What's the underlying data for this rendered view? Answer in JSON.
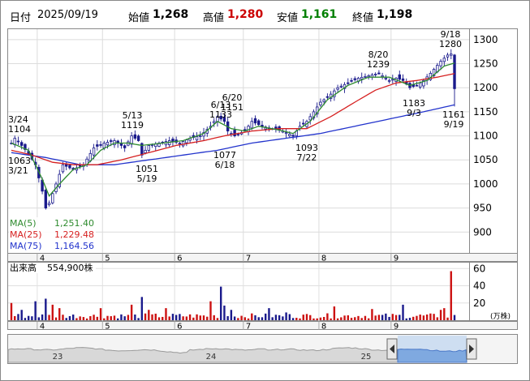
{
  "header": {
    "date_label": "日付",
    "date": "2025/09/19",
    "open_label": "始値",
    "open": "1,268",
    "high_label": "高値",
    "high": "1,280",
    "low_label": "安値",
    "low": "1,161",
    "close_label": "終値",
    "close": "1,198"
  },
  "colors": {
    "up_candle": "#ffffff",
    "down_candle": "#1a1a8c",
    "ma5": "#2e8b2e",
    "ma25": "#d62020",
    "ma75": "#2233cc",
    "high_value": "#cc0000",
    "low_value": "#008000",
    "volume_up": "#cc1111",
    "volume_down": "#1a1a8c"
  },
  "legend": {
    "ma5_label": "MA(5)",
    "ma5_value": "1,251.40",
    "ma25_label": "MA(25)",
    "ma25_value": "1,229.48",
    "ma75_label": "MA(75)",
    "ma75_value": "1,164.56"
  },
  "volume_panel": {
    "label": "出来高",
    "value": "554,900株",
    "unit": "(万株)",
    "ticks": [
      "60",
      "40",
      "20"
    ]
  },
  "navigator": {
    "year_labels": [
      "23",
      "24",
      "25"
    ]
  },
  "chart_data": {
    "type": "candlestick",
    "ylim": [
      860,
      1320
    ],
    "y_ticks": [
      900,
      950,
      1000,
      1050,
      1100,
      1150,
      1200,
      1250,
      1300
    ],
    "x_ticks": [
      "4",
      "5",
      "6",
      "7",
      "8",
      "9"
    ],
    "annotations": [
      {
        "lines": [
          "3/24",
          "1104"
        ],
        "date": "3/24",
        "value": 1104
      },
      {
        "lines": [
          "1063",
          "3/21"
        ],
        "date": "3/21",
        "value": 1063
      },
      {
        "lines": [
          "5/13",
          "1119"
        ],
        "date": "5/13",
        "value": 1119
      },
      {
        "lines": [
          "1051",
          "5/19"
        ],
        "date": "5/19",
        "value": 1051
      },
      {
        "lines": [
          "6/20",
          "1151"
        ],
        "date": "6/20",
        "value": 1151
      },
      {
        "lines": [
          "6/13",
          "1133"
        ],
        "date": "6/13",
        "value": 1133
      },
      {
        "lines": [
          "1077",
          "6/18"
        ],
        "date": "6/18",
        "value": 1077
      },
      {
        "lines": [
          "1093",
          "7/22"
        ],
        "date": "7/22",
        "value": 1093
      },
      {
        "lines": [
          "8/20",
          "1239"
        ],
        "date": "8/20",
        "value": 1239
      },
      {
        "lines": [
          "1183",
          "9/3"
        ],
        "date": "9/3",
        "value": 1183
      },
      {
        "lines": [
          "9/18",
          "1280"
        ],
        "date": "9/18",
        "value": 1280
      },
      {
        "lines": [
          "1161",
          "9/19"
        ],
        "date": "9/19",
        "value": 1161
      }
    ],
    "ohlc_anchors": [
      {
        "i": 0,
        "close": 1085
      },
      {
        "i": 1,
        "close": 1095
      },
      {
        "i": 3,
        "close": 1080
      },
      {
        "i": 5,
        "close": 1063
      },
      {
        "i": 7,
        "close": 1040
      },
      {
        "i": 9,
        "close": 985
      },
      {
        "i": 10,
        "close": 950
      },
      {
        "i": 11,
        "close": 960
      },
      {
        "i": 13,
        "close": 1000
      },
      {
        "i": 15,
        "close": 1040
      },
      {
        "i": 18,
        "close": 1030
      },
      {
        "i": 21,
        "close": 1040
      },
      {
        "i": 24,
        "close": 1075
      },
      {
        "i": 27,
        "close": 1085
      },
      {
        "i": 30,
        "close": 1090
      },
      {
        "i": 33,
        "close": 1075
      },
      {
        "i": 35,
        "close": 1100
      },
      {
        "i": 37,
        "close": 1090
      },
      {
        "i": 38,
        "close": 1060
      },
      {
        "i": 40,
        "close": 1080
      },
      {
        "i": 43,
        "close": 1085
      },
      {
        "i": 46,
        "close": 1090
      },
      {
        "i": 49,
        "close": 1085
      },
      {
        "i": 52,
        "close": 1095
      },
      {
        "i": 55,
        "close": 1100
      },
      {
        "i": 58,
        "close": 1120
      },
      {
        "i": 60,
        "close": 1140
      },
      {
        "i": 62,
        "close": 1130
      },
      {
        "i": 63,
        "close": 1110
      },
      {
        "i": 65,
        "close": 1100
      },
      {
        "i": 68,
        "close": 1110
      },
      {
        "i": 70,
        "close": 1130
      },
      {
        "i": 73,
        "close": 1120
      },
      {
        "i": 76,
        "close": 1115
      },
      {
        "i": 79,
        "close": 1110
      },
      {
        "i": 82,
        "close": 1100
      },
      {
        "i": 84,
        "close": 1120
      },
      {
        "i": 86,
        "close": 1130
      },
      {
        "i": 88,
        "close": 1150
      },
      {
        "i": 90,
        "close": 1170
      },
      {
        "i": 92,
        "close": 1180
      },
      {
        "i": 95,
        "close": 1200
      },
      {
        "i": 98,
        "close": 1210
      },
      {
        "i": 101,
        "close": 1220
      },
      {
        "i": 104,
        "close": 1225
      },
      {
        "i": 107,
        "close": 1230
      },
      {
        "i": 110,
        "close": 1215
      },
      {
        "i": 112,
        "close": 1220
      },
      {
        "i": 114,
        "close": 1215
      },
      {
        "i": 116,
        "close": 1200
      },
      {
        "i": 118,
        "close": 1205
      },
      {
        "i": 120,
        "close": 1215
      },
      {
        "i": 122,
        "close": 1230
      },
      {
        "i": 125,
        "close": 1255
      },
      {
        "i": 127,
        "close": 1268
      },
      {
        "i": 128,
        "close": 1270
      },
      {
        "i": 129,
        "close": 1198
      }
    ],
    "ma5_anchors": [
      {
        "i": 0,
        "v": 1085
      },
      {
        "i": 5,
        "v": 1070
      },
      {
        "i": 9,
        "v": 1010
      },
      {
        "i": 11,
        "v": 975
      },
      {
        "i": 14,
        "v": 1000
      },
      {
        "i": 18,
        "v": 1030
      },
      {
        "i": 22,
        "v": 1040
      },
      {
        "i": 26,
        "v": 1070
      },
      {
        "i": 30,
        "v": 1085
      },
      {
        "i": 34,
        "v": 1085
      },
      {
        "i": 38,
        "v": 1080
      },
      {
        "i": 44,
        "v": 1085
      },
      {
        "i": 50,
        "v": 1090
      },
      {
        "i": 56,
        "v": 1105
      },
      {
        "i": 60,
        "v": 1130
      },
      {
        "i": 64,
        "v": 1115
      },
      {
        "i": 68,
        "v": 1110
      },
      {
        "i": 72,
        "v": 1120
      },
      {
        "i": 78,
        "v": 1112
      },
      {
        "i": 82,
        "v": 1105
      },
      {
        "i": 87,
        "v": 1130
      },
      {
        "i": 92,
        "v": 1175
      },
      {
        "i": 98,
        "v": 1205
      },
      {
        "i": 104,
        "v": 1222
      },
      {
        "i": 110,
        "v": 1222
      },
      {
        "i": 116,
        "v": 1205
      },
      {
        "i": 121,
        "v": 1215
      },
      {
        "i": 126,
        "v": 1245
      },
      {
        "i": 129,
        "v": 1251.4
      }
    ],
    "ma25_anchors": [
      {
        "i": 0,
        "v": 1070
      },
      {
        "i": 6,
        "v": 1060
      },
      {
        "i": 12,
        "v": 1045
      },
      {
        "i": 18,
        "v": 1040
      },
      {
        "i": 25,
        "v": 1040
      },
      {
        "i": 32,
        "v": 1050
      },
      {
        "i": 40,
        "v": 1065
      },
      {
        "i": 48,
        "v": 1080
      },
      {
        "i": 56,
        "v": 1090
      },
      {
        "i": 62,
        "v": 1100
      },
      {
        "i": 70,
        "v": 1110
      },
      {
        "i": 78,
        "v": 1115
      },
      {
        "i": 86,
        "v": 1115
      },
      {
        "i": 93,
        "v": 1140
      },
      {
        "i": 100,
        "v": 1170
      },
      {
        "i": 106,
        "v": 1195
      },
      {
        "i": 112,
        "v": 1210
      },
      {
        "i": 118,
        "v": 1215
      },
      {
        "i": 124,
        "v": 1222
      },
      {
        "i": 129,
        "v": 1229.48
      }
    ],
    "ma75_anchors": [
      {
        "i": 0,
        "v": 1065
      },
      {
        "i": 10,
        "v": 1055
      },
      {
        "i": 20,
        "v": 1040
      },
      {
        "i": 30,
        "v": 1040
      },
      {
        "i": 40,
        "v": 1050
      },
      {
        "i": 50,
        "v": 1060
      },
      {
        "i": 60,
        "v": 1070
      },
      {
        "i": 70,
        "v": 1085
      },
      {
        "i": 80,
        "v": 1095
      },
      {
        "i": 90,
        "v": 1105
      },
      {
        "i": 100,
        "v": 1120
      },
      {
        "i": 110,
        "v": 1135
      },
      {
        "i": 120,
        "v": 1150
      },
      {
        "i": 129,
        "v": 1164.56
      }
    ],
    "volume_ylim": [
      0,
      65
    ],
    "volume_spikes": [
      {
        "i": 0,
        "v": 20
      },
      {
        "i": 3,
        "v": 12
      },
      {
        "i": 7,
        "v": 22
      },
      {
        "i": 10,
        "v": 25
      },
      {
        "i": 12,
        "v": 18
      },
      {
        "i": 14,
        "v": 14
      },
      {
        "i": 26,
        "v": 14
      },
      {
        "i": 35,
        "v": 18
      },
      {
        "i": 38,
        "v": 27
      },
      {
        "i": 40,
        "v": 12
      },
      {
        "i": 45,
        "v": 14
      },
      {
        "i": 58,
        "v": 22
      },
      {
        "i": 61,
        "v": 39
      },
      {
        "i": 62,
        "v": 17
      },
      {
        "i": 64,
        "v": 12
      },
      {
        "i": 75,
        "v": 14
      },
      {
        "i": 80,
        "v": 9
      },
      {
        "i": 94,
        "v": 16
      },
      {
        "i": 105,
        "v": 13
      },
      {
        "i": 114,
        "v": 18
      },
      {
        "i": 125,
        "v": 12
      },
      {
        "i": 126,
        "v": 14
      },
      {
        "i": 128,
        "v": 57
      }
    ]
  }
}
